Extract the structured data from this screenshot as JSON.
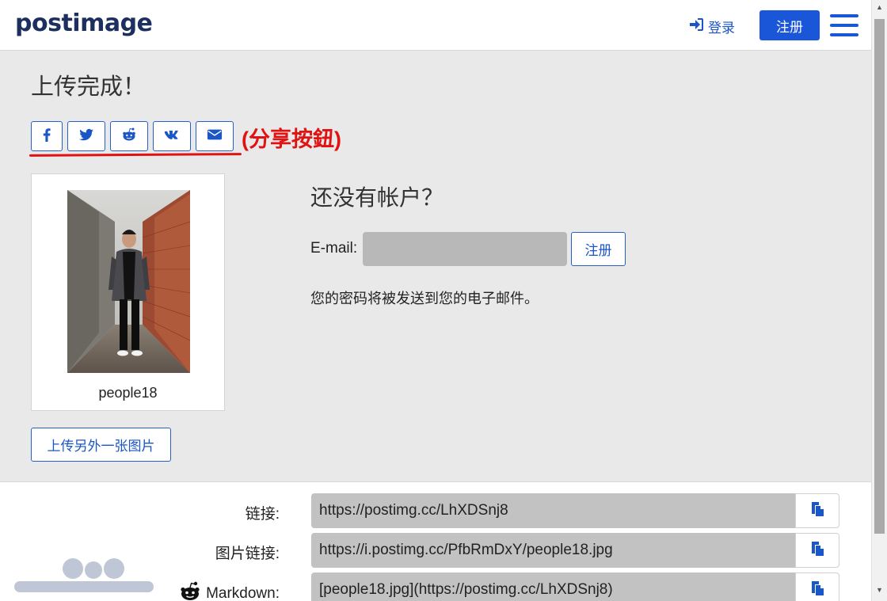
{
  "header": {
    "logo": "postimage",
    "login_label": "登录",
    "register_label": "注册"
  },
  "main": {
    "title": "上传完成！",
    "share_buttons": [
      "facebook",
      "twitter",
      "reddit",
      "vk",
      "email"
    ],
    "share_annotation": "(分享按鈕)",
    "thumbnail_name": "people18",
    "upload_another_label": "上传另外一张图片"
  },
  "signup": {
    "heading": "还没有帐户？",
    "email_label": "E-mail:",
    "email_value": "",
    "register_label": "注册",
    "note": "您的密码将被发送到您的电子邮件。"
  },
  "links": [
    {
      "label": "链接:",
      "value": "https://postimg.cc/LhXDSnj8"
    },
    {
      "label": "图片链接:",
      "value": "https://i.postimg.cc/PfbRmDxY/people18.jpg"
    },
    {
      "label": "Markdown:",
      "value": "[people18.jpg](https://postimg.cc/LhXDSnj8)"
    }
  ],
  "colors": {
    "accent": "#1a56d8",
    "annotation": "#e01212",
    "input_bg": "#b8b8b8"
  }
}
